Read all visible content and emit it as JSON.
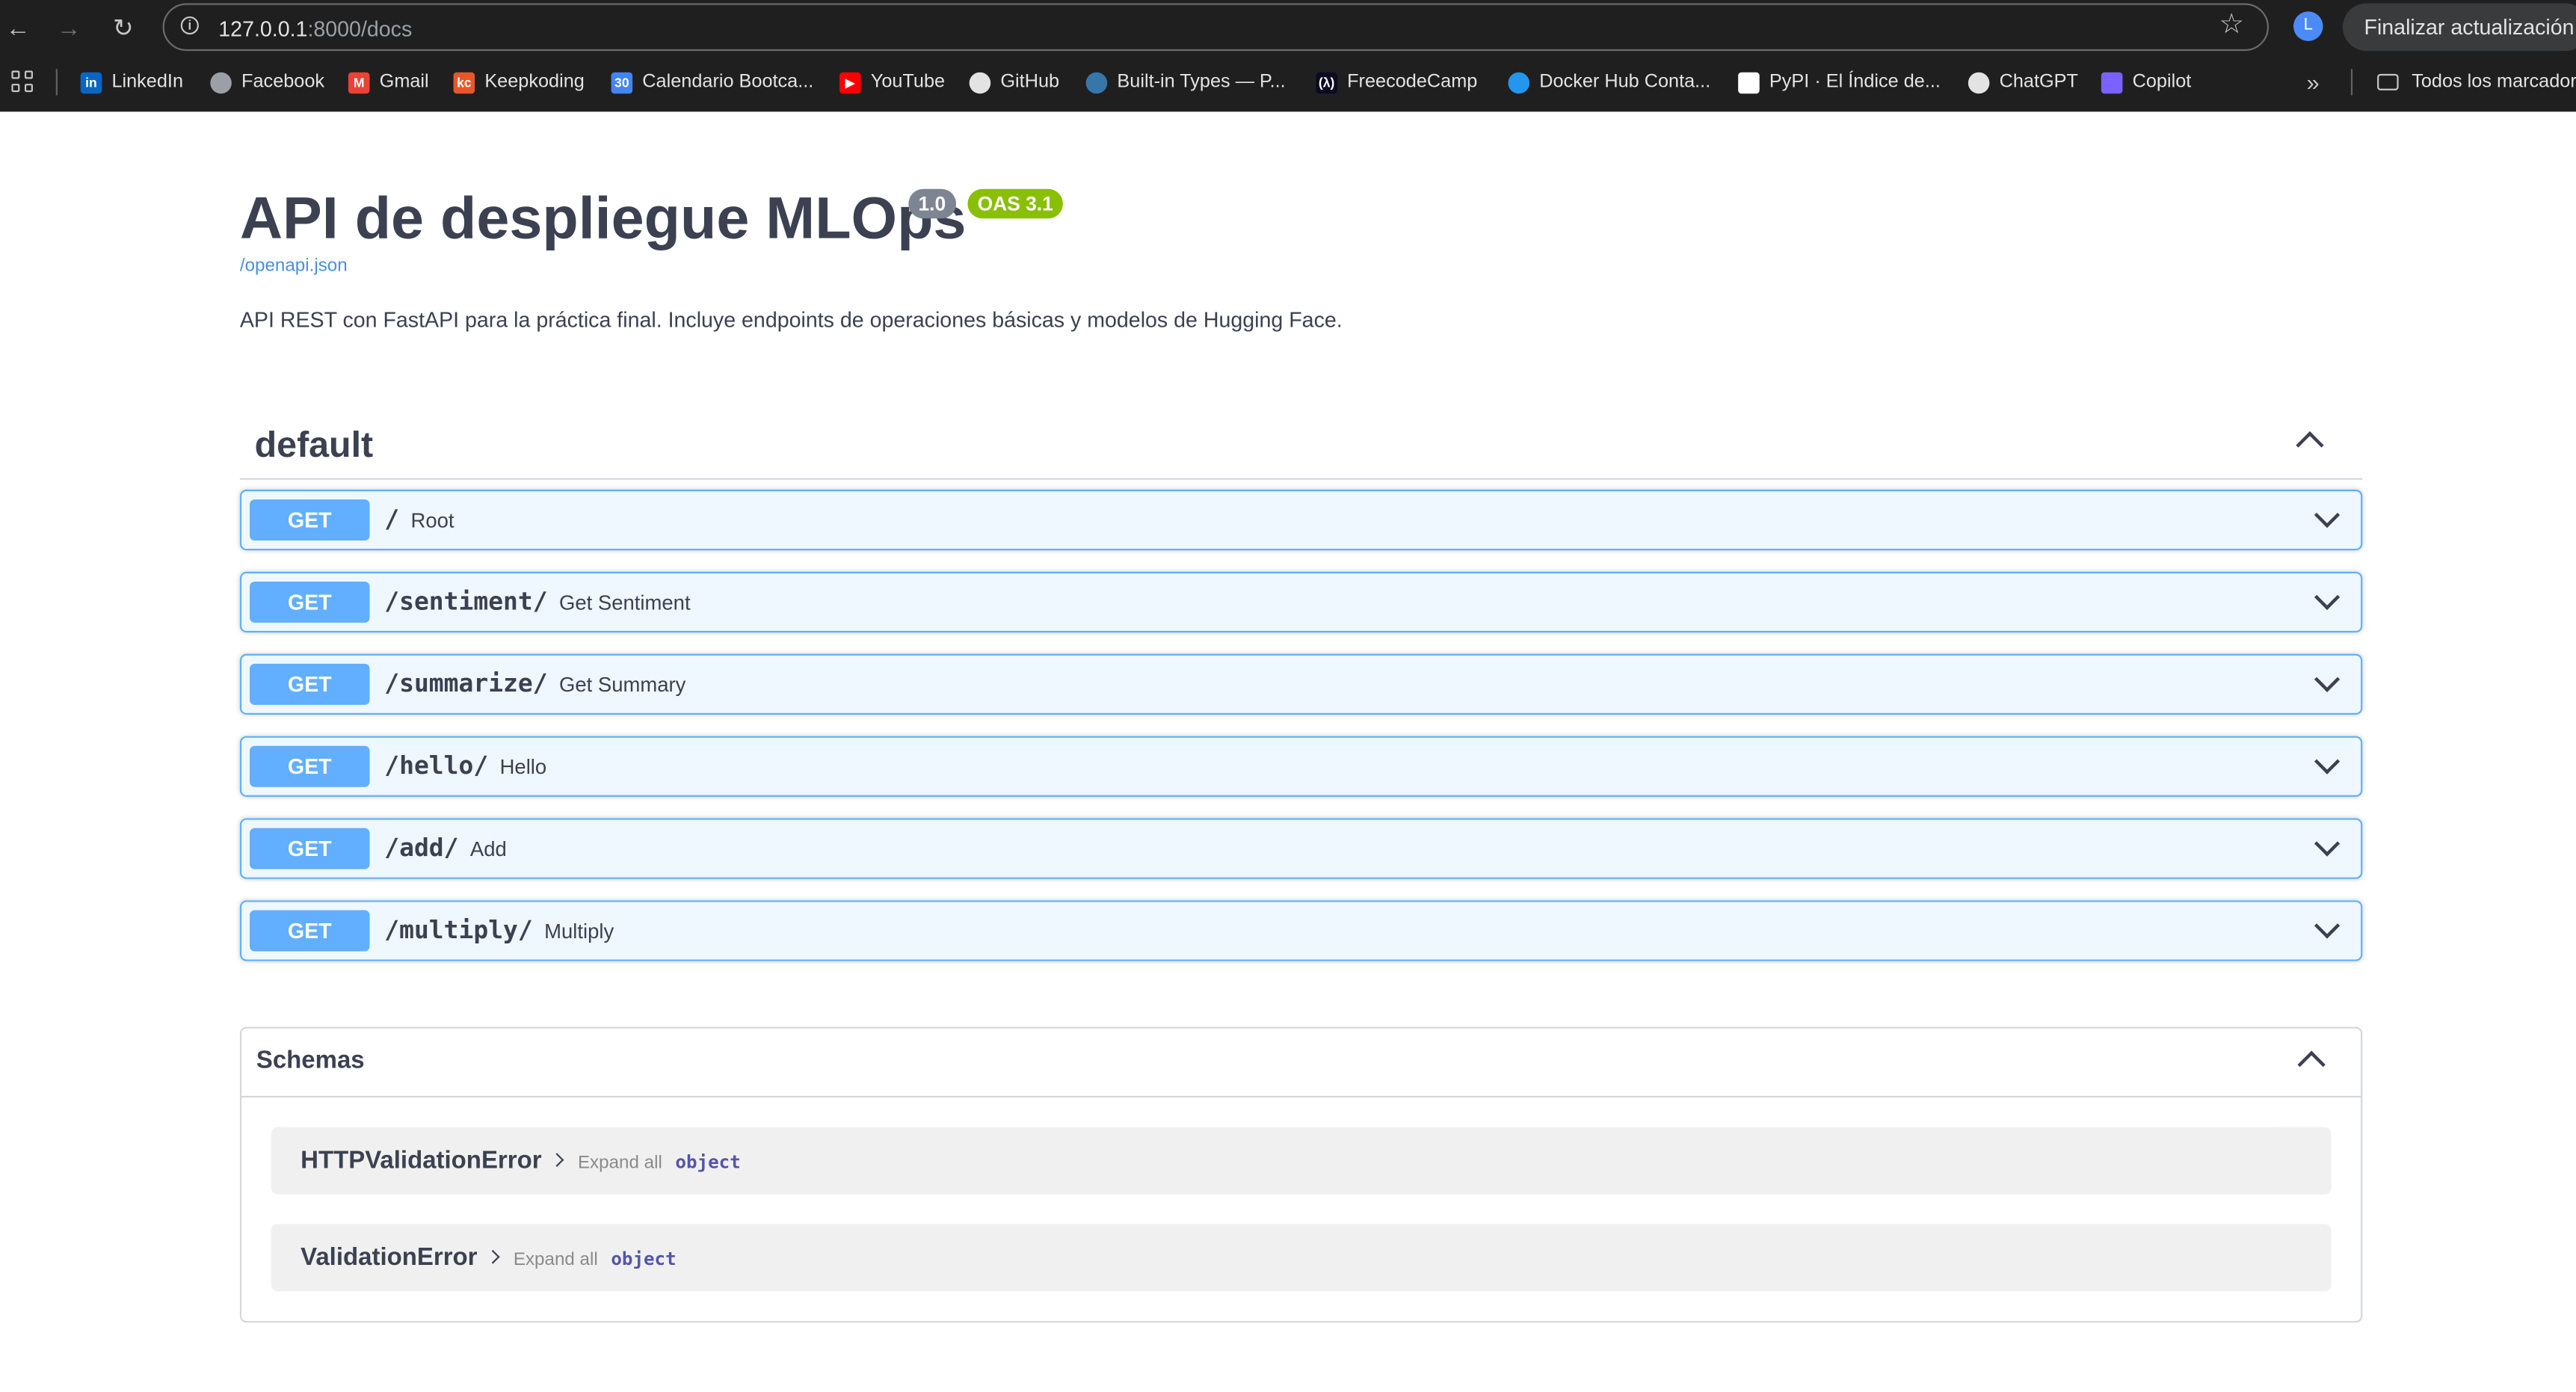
{
  "browser": {
    "url_host": "127.0.0.1",
    "url_path": ":8000/docs",
    "profile_initial": "L",
    "update_label": "Finalizar actualización",
    "bookmarks": [
      {
        "label": "LinkedIn",
        "icon": "linkedin-icon",
        "color": "#0a66c2",
        "glyph": "in"
      },
      {
        "label": "Facebook",
        "icon": "globe-icon",
        "color": "#9aa0a6",
        "glyph": ""
      },
      {
        "label": "Gmail",
        "icon": "gmail-icon",
        "color": "#ea4335",
        "glyph": "M"
      },
      {
        "label": "Keepkoding",
        "icon": "keepkoding-icon",
        "color": "#e8572a",
        "glyph": "kc"
      },
      {
        "label": "Calendario Bootca...",
        "icon": "calendar-icon",
        "color": "#4285f4",
        "glyph": "30"
      },
      {
        "label": "YouTube",
        "icon": "youtube-icon",
        "color": "#ff0000",
        "glyph": "▶"
      },
      {
        "label": "GitHub",
        "icon": "github-icon",
        "color": "#e3e3e3",
        "glyph": ""
      },
      {
        "label": "Built-in Types — P...",
        "icon": "python-icon",
        "color": "#3776ab",
        "glyph": ""
      },
      {
        "label": "FreecodeCamp",
        "icon": "freecodecamp-icon",
        "color": "#0a0a23",
        "glyph": "(λ)"
      },
      {
        "label": "Docker Hub Conta...",
        "icon": "docker-icon",
        "color": "#2496ed",
        "glyph": ""
      },
      {
        "label": "PyPI · El Índice de...",
        "icon": "pypi-icon",
        "color": "#ffffff",
        "glyph": ""
      },
      {
        "label": "ChatGPT",
        "icon": "chatgpt-icon",
        "color": "#e3e3e3",
        "glyph": ""
      },
      {
        "label": "Copilot",
        "icon": "copilot-icon",
        "color": "#7b61ff",
        "glyph": ""
      }
    ],
    "all_bookmarks_label": "Todos los marcadores"
  },
  "api": {
    "title": "API de despliegue MLOps",
    "version": "1.0",
    "oas": "OAS 3.1",
    "spec_link": "/openapi.json",
    "description": "API REST con FastAPI para la práctica final. Incluye endpoints de operaciones básicas y modelos de Hugging Face."
  },
  "section": {
    "name": "default",
    "operations": [
      {
        "method": "GET",
        "path": "/",
        "summary": "Root"
      },
      {
        "method": "GET",
        "path": "/sentiment/",
        "summary": "Get Sentiment"
      },
      {
        "method": "GET",
        "path": "/summarize/",
        "summary": "Get Summary"
      },
      {
        "method": "GET",
        "path": "/hello/",
        "summary": "Hello"
      },
      {
        "method": "GET",
        "path": "/add/",
        "summary": "Add"
      },
      {
        "method": "GET",
        "path": "/multiply/",
        "summary": "Multiply"
      }
    ]
  },
  "schemas": {
    "title": "Schemas",
    "models": [
      {
        "name": "HTTPValidationError",
        "expand": "Expand all",
        "type": "object"
      },
      {
        "name": "ValidationError",
        "expand": "Expand all",
        "type": "object"
      }
    ]
  },
  "colors": {
    "get": "#61affe",
    "title": "#3b4151",
    "link": "#4990e2",
    "oas_badge": "#89bf04",
    "version_badge": "#7d8492"
  }
}
